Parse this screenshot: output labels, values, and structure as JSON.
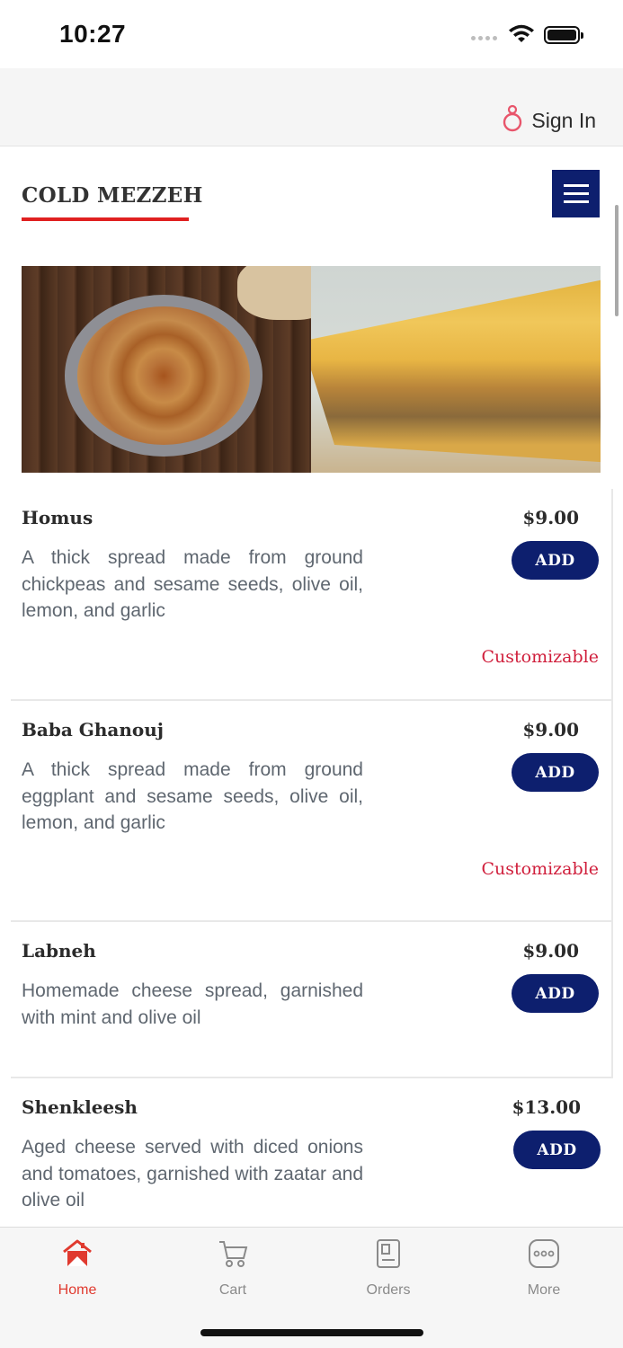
{
  "status_bar": {
    "time": "10:27"
  },
  "header": {
    "sign_in_label": "Sign In"
  },
  "section": {
    "title": "COLD MEZZEH"
  },
  "menu_items": [
    {
      "name": "Homus",
      "price": "$9.00",
      "description": "A thick spread made from ground chickpeas and sesame seeds, olive oil, lemon, and garlic",
      "add_label": "ADD",
      "customizable_label": "Customizable"
    },
    {
      "name": "Baba Ghanouj",
      "price": "$9.00",
      "description": "A thick spread made from ground eggplant and sesame seeds, olive oil, lemon, and garlic",
      "add_label": "ADD",
      "customizable_label": "Customizable"
    },
    {
      "name": "Labneh",
      "price": "$9.00",
      "description": "Homemade cheese spread, garnished with mint and olive oil",
      "add_label": "ADD"
    },
    {
      "name": "Shenkleesh",
      "price": "$13.00",
      "description": "Aged cheese served with diced onions and tomatoes, garnished with zaatar and olive oil",
      "add_label": "ADD"
    }
  ],
  "tab_bar": {
    "tabs": [
      {
        "label": "Home",
        "icon": "home-icon",
        "active": true
      },
      {
        "label": "Cart",
        "icon": "cart-icon",
        "active": false
      },
      {
        "label": "Orders",
        "icon": "orders-icon",
        "active": false
      },
      {
        "label": "More",
        "icon": "more-icon",
        "active": false
      }
    ]
  },
  "colors": {
    "primary": "#0d1f6e",
    "accent_red": "#e02020",
    "customizable": "#d01f3c",
    "tab_active": "#e03a2f",
    "tab_inactive": "#8a8a8a"
  }
}
